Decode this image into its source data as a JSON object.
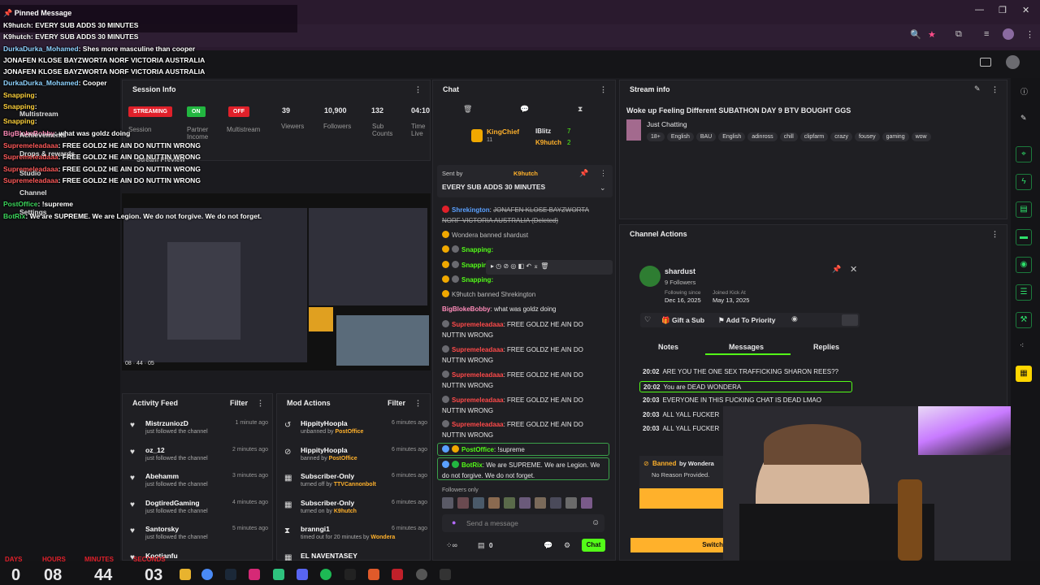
{
  "browser": {
    "icons": [
      "search-icon",
      "star-icon",
      "extension-icon",
      "playlist-icon",
      "profile-icon",
      "menu-icon"
    ],
    "window_controls": [
      "—",
      "❐",
      "✕"
    ]
  },
  "pinned": {
    "title": "Pinned Message",
    "lines": [
      {
        "user": "K9hutch",
        "text": "EVERY SUB ADDS 30 MINUTES",
        "ucolor": "#ffffff"
      },
      {
        "user": "K9hutch",
        "text": "EVERY SUB ADDS 30 MINUTES",
        "ucolor": "#ffffff"
      },
      {
        "user": "DurkaDurka_Mohamed",
        "text": "Shes more masculine than cooper",
        "ucolor": "#8fd3ff"
      },
      {
        "user": "",
        "text": "JONAFEN KLOSE BAYZWORTA NORF VICTORIA AUSTRALIA",
        "ucolor": "#ffffff"
      },
      {
        "user": "",
        "text": "JONAFEN KLOSE BAYZWORTA NORF VICTORIA AUSTRALIA",
        "ucolor": "#ffffff"
      },
      {
        "user": "DurkaDurka_Mohamed",
        "text": "Cooper",
        "ucolor": "#8fd3ff"
      },
      {
        "user": "Snapping",
        "text": "",
        "ucolor": "#ffd23c"
      },
      {
        "user": "Snapping",
        "text": "",
        "ucolor": "#ffd23c"
      },
      {
        "user": "Snapping",
        "text": "",
        "ucolor": "#ffd23c"
      },
      {
        "user": "BigBlokeBobby",
        "text": "what was goldz doing",
        "ucolor": "#ff8cba"
      },
      {
        "user": "Supremeleadaaa",
        "text": "FREE GOLDZ HE AIN DO NUTTIN WRONG",
        "ucolor": "#ff5a5a"
      },
      {
        "user": "Supremeleadaaa",
        "text": "FREE GOLDZ HE AIN DO NUTTIN WRONG",
        "ucolor": "#ff5a5a"
      },
      {
        "user": "Supremeleadaaa",
        "text": "FREE GOLDZ HE AIN DO NUTTIN WRONG",
        "ucolor": "#ff5a5a"
      },
      {
        "user": "Supremeleadaaa",
        "text": "FREE GOLDZ HE AIN DO NUTTIN WRONG",
        "ucolor": "#ff5a5a"
      },
      {
        "user": "PostOffice",
        "text": "!supreme",
        "ucolor": "#3cd65c"
      },
      {
        "user": "BotRix",
        "text": "We are SUPREME. We are Legion. We do not forgive. We do not forget.",
        "ucolor": "#3cd65c"
      }
    ]
  },
  "sidebar_labels": [
    "Multistream",
    "Achievements",
    "Drops & rewards",
    "Studio",
    "Channel",
    "Settings"
  ],
  "session": {
    "title": "Session Info",
    "streaming": "STREAMING",
    "on": "ON",
    "off": "OFF",
    "session_label": "Session",
    "partner_label": "Partner Income",
    "multistream_label": "Multistream",
    "viewers": "39",
    "viewers_label": "Viewers",
    "followers": "10,900",
    "followers_label": "Followers",
    "subs": "132",
    "subs_label": "Sub Counts",
    "time": "04:10",
    "time_label": "Time Live",
    "preview_label": "Stream Preview"
  },
  "preview": {
    "counter": "08 · 44 · 05"
  },
  "chat": {
    "title": "Chat",
    "king_label": "KingChief",
    "king_count": "11",
    "iblitz": "IBlitz",
    "iblitz_count": "7",
    "k9": "K9hutch",
    "k9_count": "2",
    "pinned_sent_by": "Sent by",
    "pinned_user": "K9hutch",
    "pinned_text": "EVERY SUB ADDS 30 MINUTES",
    "deleted_user": "Shrekington",
    "deleted_text": "JONAFEN KLOSE BAYZWORTA NORF VICTORIA AUSTRALIA (Deleted)",
    "banned1": "Wondera banned shardust",
    "snap": "Snapping:",
    "banned2": "K9hutch banned Shrekington",
    "bobby_user": "BigBlokeBobby",
    "bobby_text": "what was goldz doing",
    "supreme_user": "Supremeleadaaa",
    "supreme_text": "FREE GOLDZ HE AIN DO NUTTIN WRONG",
    "post_user": "PostOffice",
    "post_text": "!supreme",
    "botrix_user": "BotRix",
    "botrix_text": "We are SUPREME. We are Legion. We do not forgive. We do not forget.",
    "followers_only": "Followers only",
    "placeholder": "Send a message",
    "points": "0",
    "chat_button": "Chat"
  },
  "stream_info": {
    "title": "Stream info",
    "stream_title": "Woke up Feeling Different SUBATHON DAY 9 BTV BOUGHT GGS",
    "category": "Just Chatting",
    "tags": [
      "18+",
      "English",
      "BAU",
      "English",
      "adinross",
      "chill",
      "clipfarm",
      "crazy",
      "fousey",
      "gaming",
      "wow"
    ]
  },
  "channel_actions": {
    "title": "Channel Actions",
    "user": "shardust",
    "followers": "9 Followers",
    "following_since_label": "Following since",
    "following_since": "Dec 16, 2025",
    "joined_label": "Joined Kick At",
    "joined": "May 13, 2025",
    "gift": "Gift a Sub",
    "priority": "Add To Priority",
    "tabs": [
      "Notes",
      "Messages",
      "Replies"
    ],
    "messages": [
      {
        "time": "20:02",
        "text": "ARE YOU THE ONE SEX TRAFFICKING SHARON REES??",
        "hl": false
      },
      {
        "time": "20:02",
        "text": "You are DEAD WONDERA",
        "hl": true
      },
      {
        "time": "20:03",
        "text": "EVERYONE IN THIS FUCKING CHAT IS DEAD LMAO",
        "hl": false
      },
      {
        "time": "20:03",
        "text": "ALL YALL FUCKER",
        "hl": false
      },
      {
        "time": "20:03",
        "text": "ALL YALL FUCKER",
        "hl": false
      }
    ],
    "banned_label": "Banned",
    "banned_by": "by Wondera",
    "no_reason": "No Reason Provided.",
    "switch": "Switch"
  },
  "activity": {
    "title": "Activity Feed",
    "filter": "Filter",
    "items": [
      {
        "name": "MistrzuniozD",
        "sub": "just followed the channel",
        "time": "1 minute ago"
      },
      {
        "name": "oz_12",
        "sub": "just followed the channel",
        "time": "2 minutes ago"
      },
      {
        "name": "Abehamm",
        "sub": "just followed the channel",
        "time": "3 minutes ago"
      },
      {
        "name": "DogtiredGaming",
        "sub": "just followed the channel",
        "time": "4 minutes ago"
      },
      {
        "name": "Santorsky",
        "sub": "just followed the channel",
        "time": "5 minutes ago"
      },
      {
        "name": "Kootianfu",
        "sub": "",
        "time": ""
      }
    ]
  },
  "mod": {
    "title": "Mod Actions",
    "filter": "Filter",
    "items": [
      {
        "name": "HippityHoopla",
        "sub": "unbanned by",
        "by": "PostOffice",
        "time": "6 minutes ago"
      },
      {
        "name": "HippityHoopla",
        "sub": "banned by",
        "by": "PostOffice",
        "time": "6 minutes ago"
      },
      {
        "name": "Subscriber-Only",
        "sub": "turned off by",
        "by": "TTVCannonbolt",
        "time": "6 minutes ago"
      },
      {
        "name": "Subscriber-Only",
        "sub": "turned on by",
        "by": "K9hutch",
        "time": "6 minutes ago"
      },
      {
        "name": "branngi1",
        "sub": "timed out for 20 minutes by",
        "by": "Wondera",
        "time": "6 minutes ago"
      },
      {
        "name": "EL NAVENTASEY",
        "sub": "",
        "by": "",
        "time": ""
      }
    ]
  },
  "timer": {
    "days_label": "DAYS",
    "hours_label": "HOURS",
    "minutes_label": "MINUTES",
    "seconds_label": "SECONDS",
    "days": "0",
    "hours": "08",
    "minutes": "44",
    "seconds": "03"
  },
  "colors": {
    "accent": "#53fc18",
    "brand_bg": "#1f1f23",
    "red": "#e0202a",
    "yellow": "#ffc53d"
  }
}
